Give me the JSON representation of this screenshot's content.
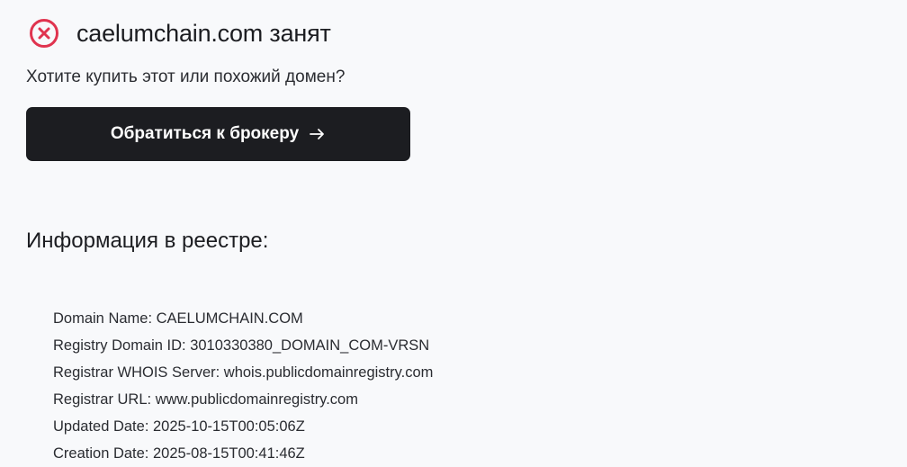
{
  "status": {
    "domain": "caelumchain.com",
    "state": "занят",
    "icon": "close-circle-icon",
    "icon_color": "#e0344f"
  },
  "offer": {
    "question": "Хотите купить этот или похожий домен?",
    "button_label": "Обратиться к брокеру",
    "button_icon": "arrow-right-icon",
    "button_color": "#1c1d21"
  },
  "registry": {
    "heading": "Информация в реестре:",
    "lines": [
      "Domain Name: CAELUMCHAIN.COM",
      "Registry Domain ID: 3010330380_DOMAIN_COM-VRSN",
      "Registrar WHOIS Server: whois.publicdomainregistry.com",
      "Registrar URL: www.publicdomainregistry.com",
      "Updated Date: 2025-10-15T00:05:06Z",
      "Creation Date: 2025-08-15T00:41:46Z"
    ]
  }
}
